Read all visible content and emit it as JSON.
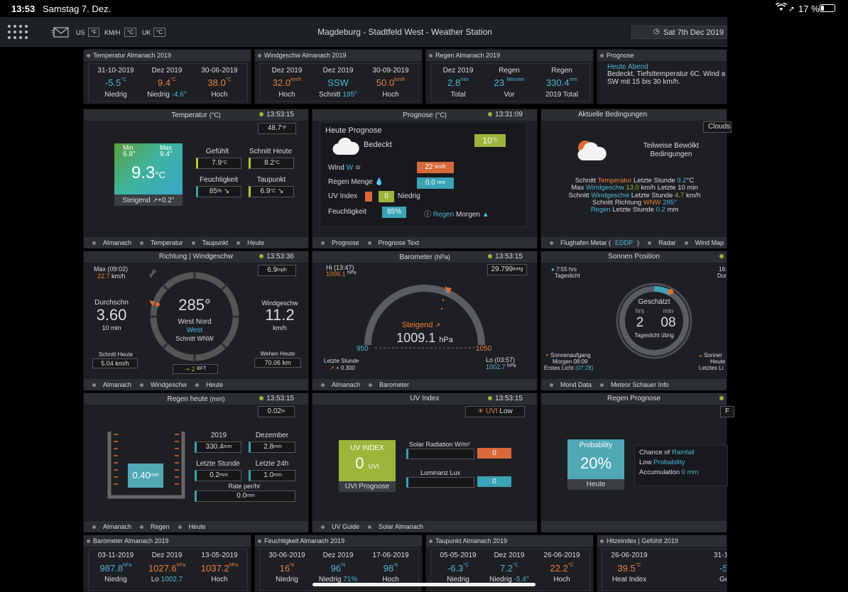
{
  "status": {
    "time": "13:53",
    "date": "Samstag 7. Dez.",
    "battery": "17 %"
  },
  "topbar": {
    "title": "Magdeburg - Stadtfeld West - Weather Station",
    "date": "Sat 7th Dec 2019",
    "us": "US",
    "us_unit": "°F",
    "kmh": "KM/H",
    "kmh_unit": "°C",
    "uk": "UK",
    "uk_unit": "°C"
  },
  "row1": {
    "temp": {
      "title": "Temperatur Almanach 2019",
      "c1": {
        "date": "31-10-2019",
        "val": "-5.5",
        "unit": "°C",
        "lbl": "Niedrig"
      },
      "c2": {
        "date": "Dez 2019",
        "val": "9.4",
        "unit": "°C",
        "lbl": "Niedrig",
        "extra": "-4.6°"
      },
      "c3": {
        "date": "30-06-2019",
        "val": "38.0",
        "unit": "°C",
        "lbl": "Hoch"
      }
    },
    "wind": {
      "title": "Windgeschw Almanach 2019",
      "c1": {
        "date": "Dez 2019",
        "val": "32.0",
        "unit": "km/h",
        "lbl": "Hoch"
      },
      "c2": {
        "date": "Dez 2019",
        "val": "SSW",
        "lbl": "Schnitt",
        "extra": "195°"
      },
      "c3": {
        "date": "30-09-2019",
        "val": "50.0",
        "unit": "km/h",
        "lbl": "Hoch"
      }
    },
    "rain": {
      "title": "Regen Almanach 2019",
      "c1": {
        "date": "Dez 2019",
        "val": "2.8",
        "unit": "mm",
        "lbl": "Total"
      },
      "c2": {
        "date": "Regen",
        "val": "23",
        "unit": "Minuten",
        "lbl": "Vor"
      },
      "c3": {
        "date": "Regen",
        "val": "330.4",
        "unit": "mm",
        "lbl": "2019 Total"
      }
    },
    "forecast": {
      "title": "Prognose",
      "head": "Heute Abend",
      "text": "Bedeckt. Tiefsttemperatur 6C. Wind a SW mit 15 bis 30 km/h."
    }
  },
  "temperature": {
    "title": "Temperatur",
    "unit": "(°C)",
    "time": "13:53:15",
    "top_box": "48.7",
    "top_unit": "°F",
    "min_lbl": "Min",
    "min": "6.8°",
    "max_lbl": "Max",
    "max": "9.4°",
    "value": "9.3",
    "value_unit": "°C",
    "trend_lbl": "Steigend",
    "trend": "+0.2°",
    "feels_lbl": "Gefühlt",
    "feels": "7.9",
    "feels_unit": "°C",
    "avg_lbl": "Schnitt Heute",
    "avg": "8.2",
    "avg_unit": "°C",
    "hum_lbl": "Feuchtigkeit",
    "hum": "85",
    "hum_unit": "%",
    "dew_lbl": "Taupunkt",
    "dew": "6.9",
    "dew_unit": "°C",
    "foot": [
      "Almanach",
      "Temperatur",
      "Taupunkt",
      "Heute"
    ]
  },
  "prognose": {
    "title": "Prognose",
    "unit": "(°C)",
    "time": "13:31:09",
    "head": "Heute Prognose",
    "cond": "Bedeckt",
    "temp": "10",
    "temp_unit": "°C",
    "wind_lbl": "Wind",
    "wind_dir": "W",
    "wind": "22",
    "wind_unit": "km/h",
    "rain_lbl": "Regen Menge",
    "rain": "0.0",
    "rain_unit": "mm",
    "uv_lbl": "UV Index",
    "uv": "0",
    "uv_txt": "Niedrig",
    "hum_lbl": "Feuchtigkeit",
    "hum": "85%",
    "rain_tom": "Regen",
    "rain_tom2": "Morgen",
    "foot": [
      "Prognose",
      "Prognose Text"
    ]
  },
  "conditions": {
    "title": "Aktuelle Bedingungen",
    "clouds": "Clouds",
    "cond": "Teilweise Bewölkt Bedingungen",
    "l1a": "Schnitt",
    "l1b": "Temperatur",
    "l1c": "Letzte Stunde",
    "l1d": "9.2",
    "l1e": "°C",
    "l2a": "Max",
    "l2b": "Windgeschw",
    "l2c": "13.0",
    "l2d": "km/h Letzte 10 min",
    "l3a": "Schnitt",
    "l3b": "Windgeschw",
    "l3c": "Letzte Stunde",
    "l3d": "4.7",
    "l3e": "km/h",
    "l4a": "Schnitt Richtung",
    "l4b": "WNW",
    "l4c": "285°",
    "l5a": "Regen",
    "l5b": "Letzte Stunde",
    "l5c": "0.2",
    "l5d": "mm",
    "foot": [
      "Flughafen Metar (",
      "EDDP",
      ")",
      "Radar",
      "Wind Map"
    ]
  },
  "windpanel": {
    "title": "Richtung | Windgeschw",
    "time": "13:53:36",
    "max_lbl": "Max (09:02)",
    "max": "22.7",
    "max_unit": "km/h",
    "box": "6.9",
    "box_unit": "mph",
    "avg_lbl": "Durchschn",
    "avg": "3.60",
    "avg_sub": "10 min",
    "dir": "285°",
    "dir_name": "West Nord",
    "dir_name2": "West",
    "dir_avg": "Schnitt WNW",
    "avg_marker": "Avg",
    "speed_lbl": "Windgeschw",
    "speed": "11.2",
    "speed_unit": "km/h",
    "today_lbl": "Schnitt Heute",
    "today": "5.04 km/h",
    "gust_lbl": "Wehen Heute",
    "gust": "70.06 km",
    "bft": "2",
    "bft_unit": "BFT",
    "foot": [
      "Almanach",
      "Windgeschw",
      "Heute"
    ]
  },
  "barometer": {
    "title": "Barometer",
    "unit": "(hPa)",
    "time": "13:53:15",
    "hi_lbl": "Hi (13:47)",
    "hi": "1009.1",
    "hi_unit": "hPa",
    "box": "29.799",
    "box_unit": "inHg",
    "trend": "Steigend",
    "value": "1009.1",
    "value_unit": "hPa",
    "min": "950",
    "max": "1050",
    "last_lbl": "Letzte Stunde",
    "last": "+ 0.300",
    "lo_lbl": "Lo (03:57)",
    "lo": "1002.7",
    "lo_unit": "hPa",
    "foot": [
      "Almanach",
      "Barometer"
    ]
  },
  "sun": {
    "title": "Sonnen Position",
    "time": "",
    "daylight": "7:55 hrs",
    "daylight_lbl": "Tageslicht",
    "right_top": "16:",
    "right_top2": "Dur",
    "est": "Geschätzt",
    "hrs": "hrs",
    "min": "min",
    "h": "2",
    "m": "08",
    "left": "Tageslicht übrig",
    "sunrise": "Sonnenaufgang",
    "sunrise2": "Morgen 08:09",
    "first": "Erstes Licht",
    "first_t": "(07:28)",
    "sunset": "Sonner",
    "sunset2": "Heute",
    "sunset3": "Letztes Li",
    "foot": [
      "Mond Data",
      "Meteor Schauer Info"
    ]
  },
  "rainpanel": {
    "title": "Regen heute",
    "unit": "(mm)",
    "time": "13:53:15",
    "box": "0.02",
    "box_unit": "in",
    "gauge": "0.40",
    "gauge_unit": "mm",
    "y_lbl": "2019",
    "y": "330.4",
    "y_unit": "mm",
    "m_lbl": "Dezember",
    "m": "2.8",
    "m_unit": "mm",
    "h_lbl": "Letzte Stunde",
    "h": "0.2",
    "h_unit": "mm",
    "d_lbl": "Letzte 24h",
    "d": "1.0",
    "d_unit": "mm",
    "rate_lbl": "Rate per/hr",
    "rate": "0.0",
    "rate_unit": "mm",
    "foot": [
      "Almanach",
      "Regen",
      "Heute"
    ]
  },
  "uv": {
    "title": "UV Index",
    "time": "13:53:15",
    "badge": "UVI",
    "badge2": "Low",
    "head": "UV INDEX",
    "value": "0",
    "value_unit": "UVI",
    "sub": "UVI Prognose",
    "solar_lbl": "Solar Radiation W/m²",
    "solar": "0",
    "lux_lbl": "Luminanz Lux",
    "lux": "0",
    "foot": [
      "UV Guide",
      "Solar Almanach"
    ]
  },
  "rainfc": {
    "title": "Regen Prognose",
    "btn": "F",
    "head": "Probability",
    "value": "20%",
    "sub": "Heute",
    "l1a": "Chance of",
    "l1b": "Rainfall",
    "l2a": "Low",
    "l2b": "Probability",
    "l3a": "Accumulation",
    "l3b": "0 mm"
  },
  "row4": {
    "baro": {
      "title": "Barometer Almanach 2019",
      "c1": {
        "date": "03-11-2019",
        "val": "987.8",
        "unit": "hPa",
        "lbl": "Niedrig"
      },
      "c2": {
        "date": "Dez 2019",
        "val": "1027.6",
        "unit": "hPa",
        "lbl": "Lo",
        "extra": "1002.7"
      },
      "c3": {
        "date": "13-05-2019",
        "val": "1037.2",
        "unit": "hPa",
        "lbl": "Hoch"
      }
    },
    "hum": {
      "title": "Feuchtigkeit Almanach 2019",
      "c1": {
        "date": "30-06-2019",
        "val": "16",
        "unit": "%",
        "lbl": "Niedrig"
      },
      "c2": {
        "date": "Dez 2019",
        "val": "96",
        "unit": "%",
        "lbl": "Niedrig",
        "extra": "71%"
      },
      "c3": {
        "date": "17-06-2019",
        "val": "98",
        "unit": "%",
        "lbl": "Hoch"
      }
    },
    "dew": {
      "title": "Taupunkt Almanach 2019",
      "c1": {
        "date": "05-05-2019",
        "val": "-6.3",
        "unit": "°C",
        "lbl": "Niedrig"
      },
      "c2": {
        "date": "Dez 2019",
        "val": "7.2",
        "unit": "°C",
        "lbl": "Niedrig",
        "extra": "-5.4°"
      },
      "c3": {
        "date": "26-06-2019",
        "val": "22.2",
        "unit": "°C",
        "lbl": "Hoch"
      }
    },
    "heat": {
      "title": "Hitzeindex | Gefühlt 2019",
      "c1": {
        "date": "26-06-2019",
        "val": "39.5",
        "unit": "°C",
        "lbl": "Heat Index"
      },
      "c2": {
        "date": "31-1",
        "val": "-5",
        "lbl": "Ge"
      }
    }
  }
}
